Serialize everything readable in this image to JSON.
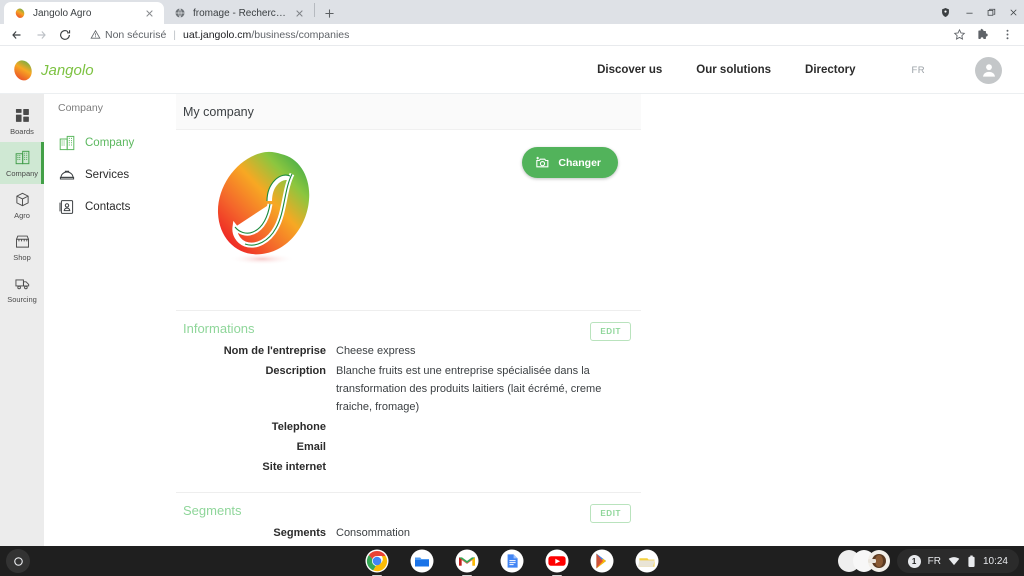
{
  "browser": {
    "tabs": [
      {
        "title": "Jangolo Agro",
        "favicon": "mango-favicon",
        "active": true
      },
      {
        "title": "fromage - Recherche Google",
        "favicon": "globe-favicon",
        "active": false
      }
    ],
    "new_tab_label": "+",
    "window_controls": {
      "shield": "shield-icon",
      "minimize": "minimize-icon",
      "maximize": "maximize-icon",
      "close": "close-icon"
    },
    "toolbar": {
      "back": "back-arrow-icon",
      "forward": "forward-arrow-icon",
      "reload": "reload-icon",
      "security_label": "Non sécurisé",
      "url_domain": "uat.jangolo.cm",
      "url_path": "/business/companies",
      "bookmark": "star-icon",
      "extensions": "puzzle-icon",
      "menu": "three-dot-menu-icon"
    }
  },
  "site_header": {
    "brand_name": "Jangolo",
    "nav": [
      {
        "label": "Discover us"
      },
      {
        "label": "Our solutions"
      },
      {
        "label": "Directory"
      }
    ],
    "language": "FR",
    "avatar": "account-avatar-icon"
  },
  "rail": {
    "items": [
      {
        "label": "Boards",
        "icon": "boards-grid-icon",
        "active": false
      },
      {
        "label": "Company",
        "icon": "company-building-icon",
        "active": true
      },
      {
        "label": "Agro",
        "icon": "agro-box-icon",
        "active": false
      },
      {
        "label": "Shop",
        "icon": "shop-store-icon",
        "active": false
      },
      {
        "label": "Sourcing",
        "icon": "sourcing-truck-icon",
        "active": false
      }
    ]
  },
  "submenu": {
    "title": "Company",
    "items": [
      {
        "label": "Company",
        "icon": "building-icon",
        "active": true
      },
      {
        "label": "Services",
        "icon": "services-icon",
        "active": false
      },
      {
        "label": "Contacts",
        "icon": "contacts-card-icon",
        "active": false
      }
    ]
  },
  "card": {
    "header_title": "My company",
    "logo_alt": "company-mango-logo",
    "change_photo_label": "Changer",
    "change_photo_icon": "add-photo-camera-icon",
    "sections": [
      {
        "title": "Informations",
        "edit_label": "EDIT",
        "fields": [
          {
            "label": "Nom de l'entreprise",
            "value": "Cheese express"
          },
          {
            "label": "Description",
            "value": "Blanche fruits est une entreprise spécialisée dans la transformation des produits laitiers (lait écrémé, creme fraiche, fromage)"
          },
          {
            "label": "Telephone",
            "value": ""
          },
          {
            "label": "Email",
            "value": ""
          },
          {
            "label": "Site internet",
            "value": ""
          }
        ]
      },
      {
        "title": "Segments",
        "edit_label": "EDIT",
        "fields": [
          {
            "label": "Segments",
            "value": "Consommation"
          }
        ]
      }
    ]
  },
  "shelf": {
    "launcher": "launcher-circle-icon",
    "apps": [
      {
        "name": "chrome-app-icon",
        "open": true
      },
      {
        "name": "files-app-icon",
        "open": false
      },
      {
        "name": "gmail-app-icon",
        "open": true
      },
      {
        "name": "docs-app-icon",
        "open": false
      },
      {
        "name": "youtube-app-icon",
        "open": true
      },
      {
        "name": "play-store-app-icon",
        "open": false
      },
      {
        "name": "gallery-app-icon",
        "open": false
      }
    ],
    "tray": {
      "notification_count": "1",
      "language": "FR",
      "network": "wifi-icon",
      "battery": "battery-icon",
      "time": "10:24"
    }
  },
  "colors": {
    "brand_green": "#52b35b",
    "accent_light_green": "#8fd69a",
    "rail_active_bg": "#cfe8d3",
    "shelf_bg": "#1f1f1f"
  }
}
